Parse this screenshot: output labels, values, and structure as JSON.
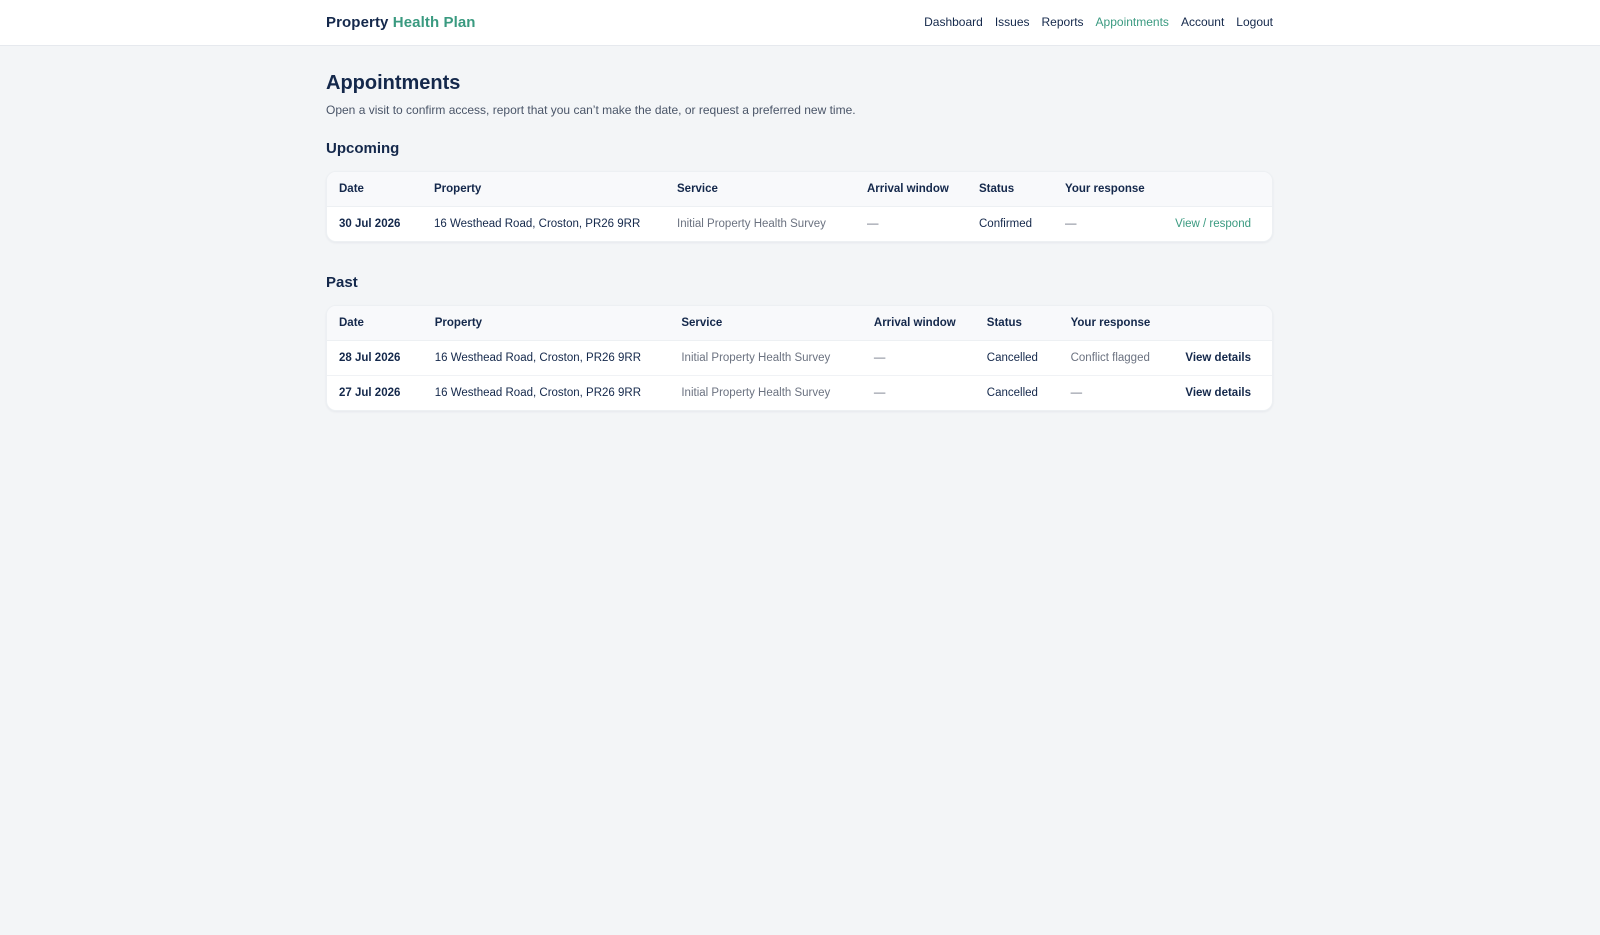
{
  "brand": {
    "part1": "Property",
    "part2": "Health Plan"
  },
  "nav": [
    {
      "label": "Dashboard"
    },
    {
      "label": "Issues"
    },
    {
      "label": "Reports"
    },
    {
      "label": "Appointments",
      "active": true
    },
    {
      "label": "Account"
    },
    {
      "label": "Logout"
    }
  ],
  "page": {
    "title": "Appointments",
    "subtitle": "Open a visit to confirm access, report that you can’t make the date, or request a preferred new time."
  },
  "upcoming": {
    "title": "Upcoming",
    "columns": [
      "Date",
      "Property",
      "Service",
      "Arrival window",
      "Status",
      "Your response"
    ],
    "rows": [
      {
        "date": "30 Jul 2026",
        "property": "16 Westhead Road, Croston, PR26 9RR",
        "service": "Initial Property Health Survey",
        "arrival": "—",
        "status": "Confirmed",
        "response": "—",
        "action": "View / respond"
      }
    ]
  },
  "past": {
    "title": "Past",
    "columns": [
      "Date",
      "Property",
      "Service",
      "Arrival window",
      "Status",
      "Your response"
    ],
    "rows": [
      {
        "date": "28 Jul 2026",
        "property": "16 Westhead Road, Croston, PR26 9RR",
        "service": "Initial Property Health Survey",
        "arrival": "—",
        "status": "Cancelled",
        "response": "Conflict flagged",
        "action": "View details"
      },
      {
        "date": "27 Jul 2026",
        "property": "16 Westhead Road, Croston, PR26 9RR",
        "service": "Initial Property Health Survey",
        "arrival": "—",
        "status": "Cancelled",
        "response": "—",
        "action": "View details"
      }
    ]
  },
  "colors": {
    "accent": "#3a9a80",
    "text": "#14284b",
    "background": "#f3f5f7"
  }
}
